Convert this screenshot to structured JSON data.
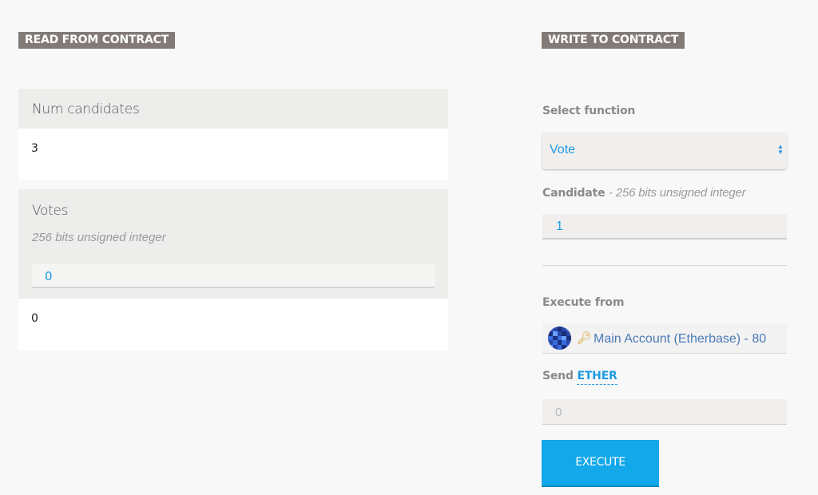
{
  "read": {
    "title": "READ FROM CONTRACT",
    "items": [
      {
        "name": "Num candidates",
        "value": "3"
      },
      {
        "name": "Votes",
        "hint": "256 bits unsigned integer",
        "input_value": "0",
        "value": "0"
      }
    ]
  },
  "write": {
    "title": "WRITE TO CONTRACT",
    "select_label": "Select function",
    "selected_function": "Vote",
    "param_name": "Candidate",
    "param_type": "- 256 bits unsigned integer",
    "param_value": "1",
    "execute_from_label": "Execute from",
    "account": "Main Account (Etherbase) - 80",
    "send_label": "Send",
    "send_unit": "ETHER",
    "ether_placeholder": "0",
    "execute_label": "EXECUTE"
  },
  "colors": {
    "accent": "#12a8e9",
    "title_bg": "#827a76",
    "background": "#f8f8f8"
  },
  "icons": {
    "select_arrows": "select-arrows-icon",
    "key": "key-icon",
    "avatar": "identicon-avatar"
  }
}
